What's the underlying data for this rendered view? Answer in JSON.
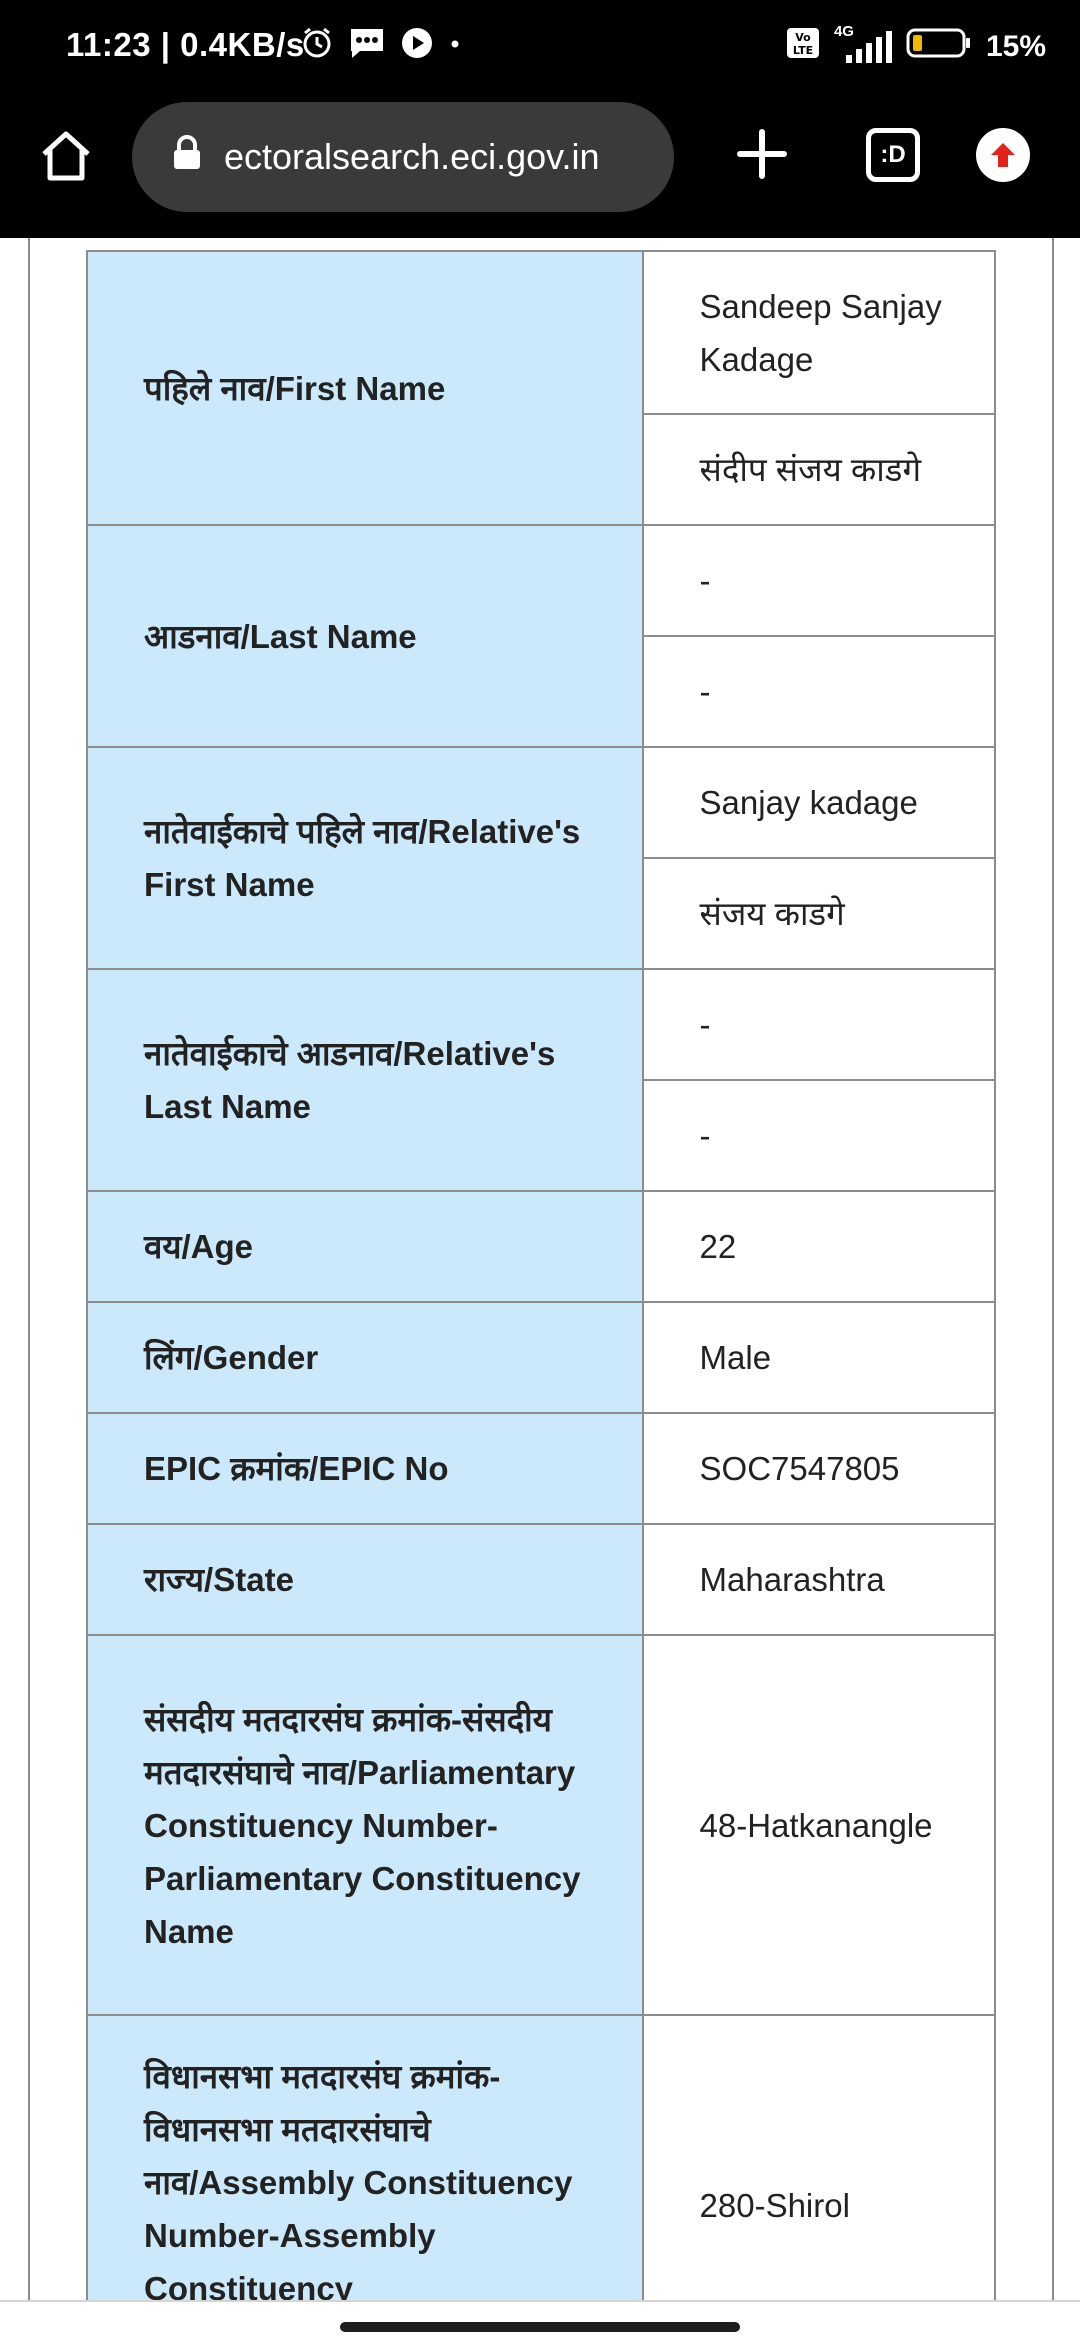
{
  "status_bar": {
    "time": "11:23 | 0.4KB/s",
    "network": "4G",
    "battery": "15%"
  },
  "browser": {
    "url": "ectoralsearch.eci.gov.in",
    "tabs_label": ":D"
  },
  "details": {
    "first_name_label": "पहिले नाव/First Name",
    "first_name_en": "Sandeep Sanjay Kadage",
    "first_name_mr": "संदीप संजय काडगे",
    "last_name_label": "आडनाव/Last Name",
    "last_name_en": "-",
    "last_name_mr": "-",
    "relative_first_label": "नातेवाईकाचे पहिले नाव/Relative's First Name",
    "relative_first_en": "Sanjay kadage",
    "relative_first_mr": "संजय काडगे",
    "relative_last_label": "नातेवाईकाचे आडनाव/Relative's Last Name",
    "relative_last_en": "-",
    "relative_last_mr": "-",
    "age_label": "वय/Age",
    "age": "22",
    "gender_label": "लिंग/Gender",
    "gender": "Male",
    "epic_label": "EPIC क्रमांक/EPIC No",
    "epic": "SOC7547805",
    "state_label": "राज्य/State",
    "state": "Maharashtra",
    "pc_label": "संसदीय मतदारसंघ क्रमांक-संसदीय मतदारसंघाचे नाव/Parliamentary Constituency Number-Parliamentary Constituency Name",
    "pc": "48-Hatkanangle",
    "ac_label": "विधानसभा मतदारसंघ क्रमांक-विधानसभा मतदारसंघाचे नाव/Assembly Constituency Number-Assembly Constituency",
    "ac": "280-Shirol"
  }
}
